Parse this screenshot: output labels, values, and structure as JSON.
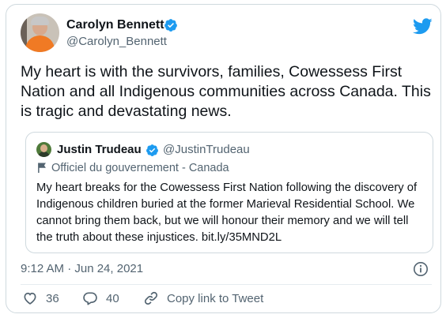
{
  "tweet": {
    "author_name": "Carolyn Bennett",
    "author_handle": "@Carolyn_Bennett",
    "text": "My heart is with the survivors, families, Cowessess First Nation and all Indigenous communities across Canada. This is tragic and devastating news.",
    "timestamp": "9:12 AM · Jun 24, 2021"
  },
  "quoted": {
    "author_name": "Justin Trudeau",
    "author_handle": "@JustinTrudeau",
    "label": "Officiel du gouvernement - Canada",
    "text": "My heart breaks for the Cowessess First Nation following the discovery of Indigenous children buried at the former Marieval Residential School. We cannot bring them back, but we will honour their memory and we will tell the truth about these injustices. bit.ly/35MND2L"
  },
  "actions": {
    "like_count": "36",
    "reply_count": "40",
    "copy_link_label": "Copy link to Tweet"
  },
  "icons": {
    "brand": "twitter-bird-icon",
    "verified": "verified-badge-icon",
    "label": "flag-icon",
    "info": "info-icon",
    "like": "heart-icon",
    "reply": "reply-icon",
    "copy": "link-icon"
  },
  "colors": {
    "accent": "#1d9bf0",
    "text": "#0f1419",
    "secondary": "#536471",
    "border": "#cfd9de"
  }
}
